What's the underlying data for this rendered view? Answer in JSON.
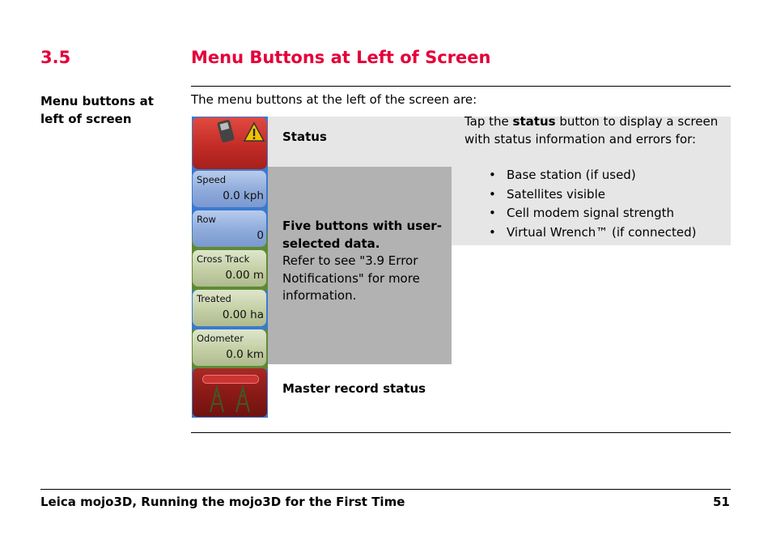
{
  "section": {
    "number": "3.5",
    "title": "Menu Buttons at Left of Screen"
  },
  "side_label": "Menu buttons at left of screen",
  "intro": "The menu buttons at the left of the screen are:",
  "rows": {
    "status_label": "Status",
    "status_info": {
      "pre": "Tap the ",
      "bold": "status",
      "post": " button to display a screen with status information and errors for:",
      "bullets": [
        "Base station (if used)",
        "Satellites visible",
        "Cell modem signal strength",
        "Virtual Wrench™ (if connected)"
      ]
    },
    "five_bold": "Five buttons with user-selected data.",
    "five_text": "Refer to see \"3.9 Error Notifications\" for more information.",
    "master_label": "Master record status"
  },
  "device_buttons": [
    {
      "label": "Speed",
      "value": "0.0 kph",
      "style": "blue"
    },
    {
      "label": "Row",
      "value": "0",
      "style": "blue"
    },
    {
      "label": "Cross Track",
      "value": "0.00 m",
      "style": "green"
    },
    {
      "label": "Treated",
      "value": "0.00 ha",
      "style": "green"
    },
    {
      "label": "Odometer",
      "value": "0.0 km",
      "style": "green"
    }
  ],
  "icons": [
    "cell-phone-icon",
    "warning-icon",
    "master-record-icon"
  ],
  "colors": {
    "heading": "#e4003a",
    "cell_light": "#e6e6e6",
    "cell_dark": "#b2b2b2"
  },
  "footer": {
    "title": "Leica mojo3D, Running the mojo3D for the First Time",
    "page": "51"
  }
}
